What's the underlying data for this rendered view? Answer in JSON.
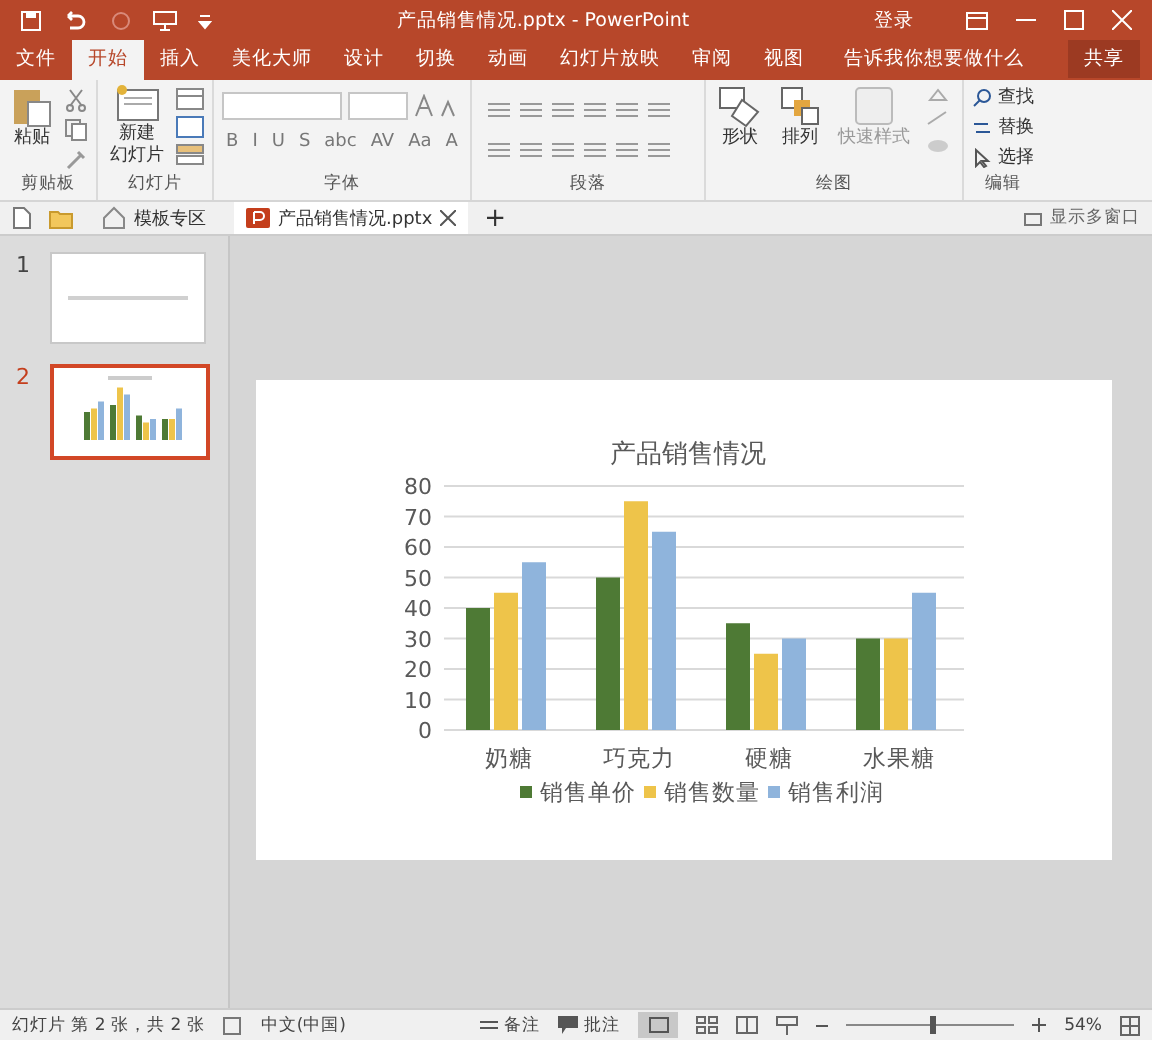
{
  "window": {
    "title": "产品销售情况.pptx - PowerPoint",
    "login": "登录"
  },
  "ribbon_tabs": [
    {
      "label": "文件",
      "selected": false
    },
    {
      "label": "开始",
      "selected": true
    },
    {
      "label": "插入",
      "selected": false
    },
    {
      "label": "美化大师",
      "selected": false
    },
    {
      "label": "设计",
      "selected": false
    },
    {
      "label": "切换",
      "selected": false
    },
    {
      "label": "动画",
      "selected": false
    },
    {
      "label": "幻灯片放映",
      "selected": false
    },
    {
      "label": "审阅",
      "selected": false
    },
    {
      "label": "视图",
      "selected": false
    }
  ],
  "tell_me": "告诉我你想要做什么",
  "share": "共享",
  "ribbon": {
    "paste": "粘贴",
    "clipboard": "剪贴板",
    "new_slide_1": "新建",
    "new_slide_2": "幻灯片",
    "slides": "幻灯片",
    "font_buttons": [
      "B",
      "I",
      "U",
      "S",
      "abc",
      "AV",
      "Aa",
      "A"
    ],
    "font": "字体",
    "paragraph": "段落",
    "shape": "形状",
    "arrange": "排列",
    "quick_style": "快速样式",
    "drawing": "绘图",
    "find": "查找",
    "replace": "替换",
    "select": "选择",
    "editing": "编辑"
  },
  "doc_tabs": [
    {
      "label": "模板专区",
      "kind": "home",
      "selected": false
    },
    {
      "label": "产品销售情况.pptx",
      "kind": "file",
      "selected": true
    }
  ],
  "new_tab": "+",
  "multi_window": "显示多窗口",
  "thumbnails": [
    {
      "number": "1",
      "selected": false
    },
    {
      "number": "2",
      "selected": true
    }
  ],
  "slide": {
    "chart_data": {
      "type": "bar",
      "title": "产品销售情况",
      "categories": [
        "奶糖",
        "巧克力",
        "硬糖",
        "水果糖"
      ],
      "ylim": [
        0,
        80
      ],
      "yticks": [
        0,
        10,
        20,
        30,
        40,
        50,
        60,
        70,
        80
      ],
      "grid": true,
      "legend": true,
      "series": [
        {
          "name": "销售单价",
          "color": "#4e7a35",
          "values": [
            40,
            50,
            35,
            30
          ]
        },
        {
          "name": "销售数量",
          "color": "#eec44a",
          "values": [
            45,
            75,
            25,
            30
          ]
        },
        {
          "name": "销售利润",
          "color": "#8fb4dc",
          "values": [
            55,
            65,
            30,
            45
          ]
        }
      ]
    }
  },
  "status_bar": {
    "slide_info": "幻灯片 第 2 张，共 2 张",
    "language": "中文(中国)",
    "notes": "备注",
    "comments": "批注",
    "zoom_slider": {
      "level": 0.5
    },
    "zoom": "54%"
  }
}
